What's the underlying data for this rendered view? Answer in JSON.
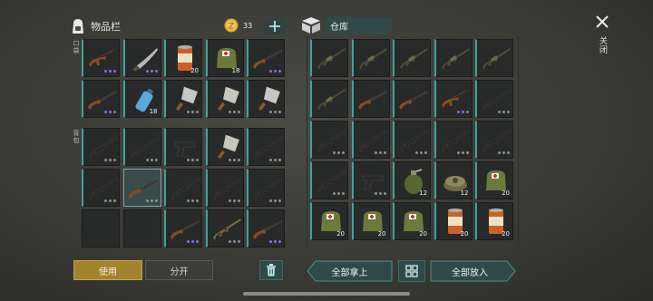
{
  "inventory": {
    "title": "物品栏",
    "coins": "33",
    "quick_label": "口袋",
    "backpack_label": "背包",
    "slots": [
      {
        "icon": "ak-rifle-icon",
        "dots": "purple"
      },
      {
        "icon": "machete-icon",
        "dots": "purple"
      },
      {
        "icon": "canned-food-icon",
        "qty": "20"
      },
      {
        "icon": "green-pack-icon",
        "qty": "18"
      },
      {
        "icon": "shotgun-icon",
        "dots": "purple"
      },
      {
        "icon": "shotgun-icon",
        "dots": "purple"
      },
      {
        "icon": "water-bottle-icon",
        "qty": "18"
      },
      {
        "icon": "cleaver-icon",
        "dots": "gray"
      },
      {
        "icon": "cleaver-icon",
        "dots": "gray"
      },
      {
        "icon": "cleaver-icon",
        "dots": "gray"
      },
      {
        "icon": "black-rifle-icon",
        "dots": "gray"
      },
      {
        "icon": "black-rifle-icon",
        "dots": "gray"
      },
      {
        "icon": "pistol-icon",
        "dots": "gray"
      },
      {
        "icon": "cleaver-icon",
        "dots": "gray"
      },
      {
        "icon": "black-rifle-icon",
        "dots": "gray"
      },
      {
        "icon": "black-rifle-icon",
        "dots": "gray"
      },
      {
        "icon": "shotgun-icon",
        "dots": "gray"
      },
      {
        "icon": "black-rifle-icon",
        "dots": "gray"
      },
      {
        "icon": "black-rifle-icon",
        "dots": "gray"
      },
      {
        "icon": "black-rifle-icon",
        "dots": "gray"
      },
      {
        "icon": "empty"
      },
      {
        "icon": "empty"
      },
      {
        "icon": "shotgun-icon",
        "dots": "purple"
      },
      {
        "icon": "camo-rifle-icon",
        "dots": "gray"
      },
      {
        "icon": "shotgun-icon",
        "dots": "purple"
      }
    ],
    "use_button": "使用",
    "split_button": "分开"
  },
  "warehouse": {
    "title": "仓库",
    "slots": [
      {
        "icon": "green-rifle-icon"
      },
      {
        "icon": "green-rifle-icon"
      },
      {
        "icon": "green-rifle-icon"
      },
      {
        "icon": "green-rifle-icon"
      },
      {
        "icon": "green-rifle-icon"
      },
      {
        "icon": "green-rifle-icon"
      },
      {
        "icon": "shotgun-icon"
      },
      {
        "icon": "shotgun-icon"
      },
      {
        "icon": "ak-rifle-icon",
        "dots": "purple"
      },
      {
        "icon": "black-rifle-icon",
        "dots": "gray"
      },
      {
        "icon": "black-rifle-icon",
        "dots": "gray"
      },
      {
        "icon": "black-rifle-icon",
        "dots": "gray"
      },
      {
        "icon": "black-rifle-icon",
        "dots": "gray"
      },
      {
        "icon": "black-rifle-icon",
        "dots": "gray"
      },
      {
        "icon": "black-rifle-icon",
        "dots": "gray"
      },
      {
        "icon": "black-rifle-icon",
        "dots": "gray"
      },
      {
        "icon": "pistol-icon",
        "dots": "gray"
      },
      {
        "icon": "grenade-icon",
        "qty": "12"
      },
      {
        "icon": "landmine-icon",
        "qty": "12"
      },
      {
        "icon": "green-pack-icon",
        "qty": "20"
      },
      {
        "icon": "green-pack-icon",
        "qty": "20"
      },
      {
        "icon": "green-pack-icon",
        "qty": "20"
      },
      {
        "icon": "green-pack-icon",
        "qty": "20"
      },
      {
        "icon": "canned-food-icon",
        "qty": "20"
      },
      {
        "icon": "canned-food-icon",
        "qty": "20"
      }
    ],
    "take_all_button": "全部拿上",
    "put_all_button": "全部放入"
  },
  "close_label": "关闭",
  "colors": {
    "accent_gold": "#a2832e",
    "accent_teal": "#3fa39b",
    "slot_bg": "#272a29"
  }
}
